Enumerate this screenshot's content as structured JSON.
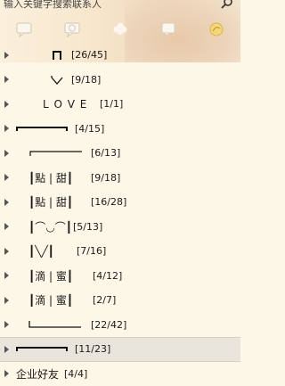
{
  "search": {
    "placeholder": "输入关键字搜索联系人"
  },
  "tabs": [
    {
      "label": "contacts"
    },
    {
      "label": "recent"
    },
    {
      "label": "groups"
    },
    {
      "label": "discussion"
    },
    {
      "label": "more"
    }
  ],
  "groups": [
    {
      "name": "",
      "count": "[26/45]"
    },
    {
      "name": "",
      "count": "[9/18]"
    },
    {
      "name": "L O V E",
      "count": "[1/1]"
    },
    {
      "name": "",
      "count": "[4/15]"
    },
    {
      "name": "",
      "count": "[6/13]"
    },
    {
      "name": "┃點 | 甜┃",
      "count": "[9/18]"
    },
    {
      "name": "┃點 | 甜┃",
      "count": "[16/28]"
    },
    {
      "name": "┃⌒◡⌒┃",
      "count": "[5/13]"
    },
    {
      "name": "┃╲╱┃",
      "count": "[7/16]"
    },
    {
      "name": "┃滴 | 蜜┃",
      "count": "[4/12]"
    },
    {
      "name": "┃滴 | 蜜┃",
      "count": "[2/7]"
    },
    {
      "name": "",
      "count": "[22/42]"
    },
    {
      "name": "",
      "count": "[11/23]"
    },
    {
      "name": "企业好友",
      "count": "[4/4]"
    }
  ],
  "colors": {
    "background": "#fdf7e8",
    "selected": "#e9e5dc",
    "text": "#1a1a1a"
  }
}
